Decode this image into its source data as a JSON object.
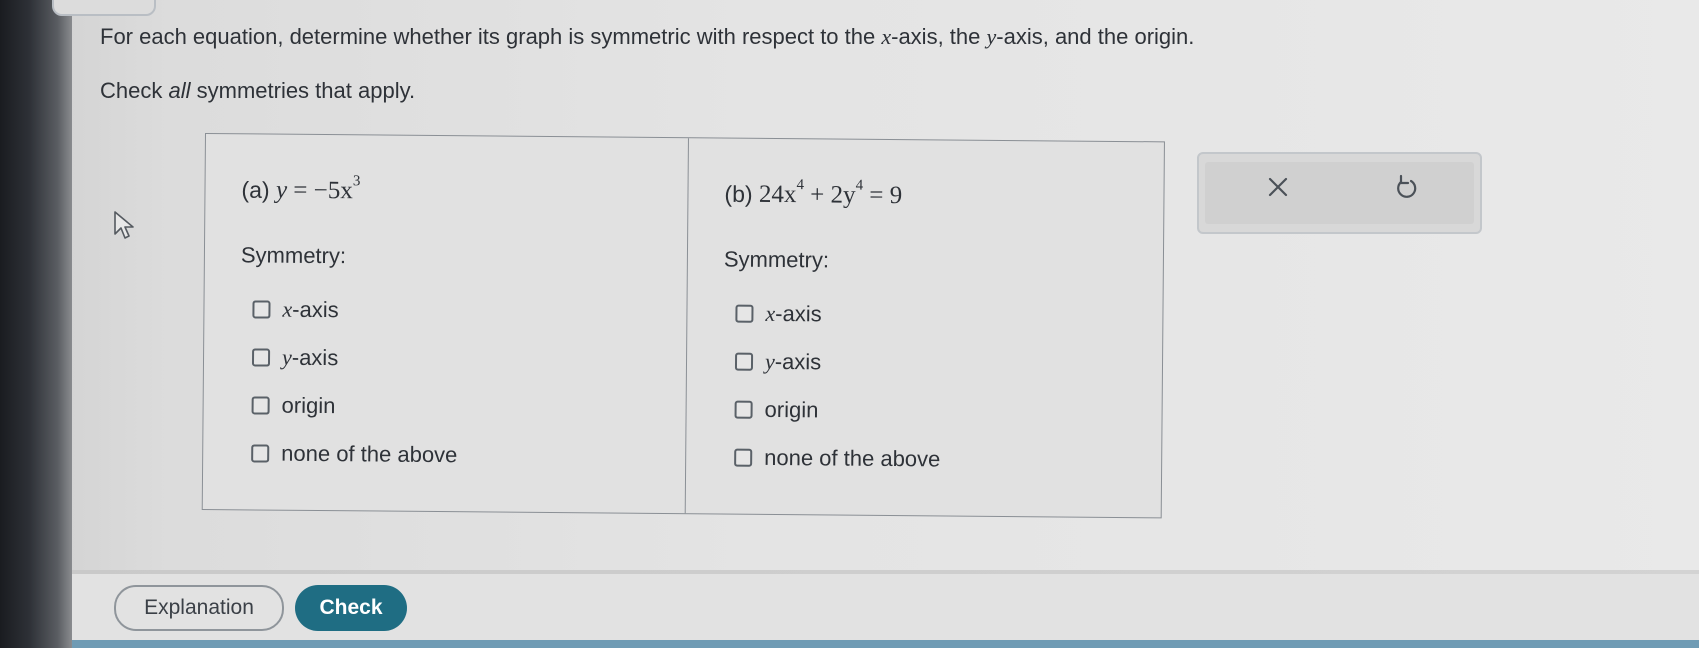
{
  "instructions": {
    "line1_pre": "For each equation, determine whether its graph is symmetric with respect to the ",
    "line1_x": "x",
    "line1_mid1": "-axis, the ",
    "line1_y": "y",
    "line1_post": "-axis, and the origin.",
    "line2_pre": "Check ",
    "line2_em": "all",
    "line2_post": " symmetries that apply."
  },
  "part_a": {
    "tag": "(a) ",
    "equation": {
      "lhs": "y",
      "rhs": " = −5x",
      "exp": "3"
    },
    "symmetry_label": "Symmetry:",
    "options": [
      {
        "var": "x",
        "label": "-axis",
        "checked": false
      },
      {
        "var": "y",
        "label": "-axis",
        "checked": false
      },
      {
        "var": "",
        "label": "origin",
        "checked": false
      },
      {
        "var": "",
        "label": "none of the above",
        "checked": false
      }
    ]
  },
  "part_b": {
    "tag": "(b) ",
    "equation": {
      "t1": "24x",
      "e1": "4",
      "t2": " + 2y",
      "e2": "4",
      "t3": " = 9"
    },
    "symmetry_label": "Symmetry:",
    "options": [
      {
        "var": "x",
        "label": "-axis",
        "checked": false
      },
      {
        "var": "y",
        "label": "-axis",
        "checked": false
      },
      {
        "var": "",
        "label": "origin",
        "checked": false
      },
      {
        "var": "",
        "label": "none of the above",
        "checked": false
      }
    ]
  },
  "tools": {
    "clear_icon": "close-icon",
    "undo_icon": "undo-icon"
  },
  "footer": {
    "explanation_label": "Explanation",
    "check_label": "Check"
  },
  "colors": {
    "check_button": "#1f6d83",
    "text": "#2e3238"
  }
}
